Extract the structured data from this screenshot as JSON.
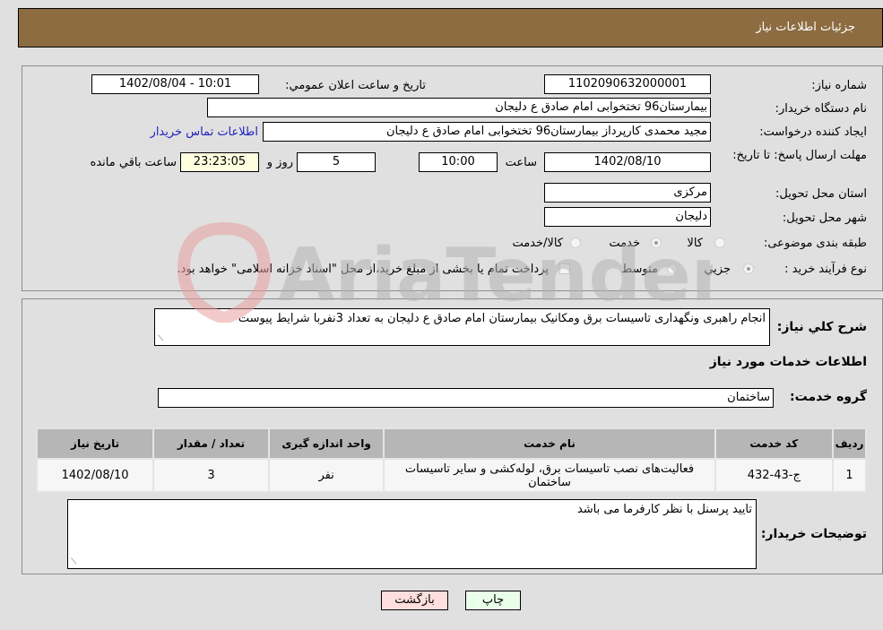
{
  "header": {
    "title": "جزئيات اطلاعات نياز"
  },
  "fields": {
    "need_number_label": "شماره نياز:",
    "need_number": "1102090632000001",
    "announce_label": "تاريخ و ساعت اعلان عمومي:",
    "announce_value": "1402/08/04 - 10:01",
    "buyer_org_label": "نام دستگاه خريدار:",
    "buyer_org": "بيمارستان96 تختخوابی امام صادق  ع   دليجان",
    "creator_label": "ايجاد کننده درخواست:",
    "creator": "مجيد  محمدی  کارپرداز بيمارستان96 تختخوابی امام صادق  ع   دليجان",
    "contact_link": "اطلاعات تماس خريدار",
    "deadline_label": "مهلت ارسال پاسخ: تا تاريخ:",
    "deadline_date": "1402/08/10",
    "time_label": "ساعت",
    "deadline_time": "10:00",
    "days": "5",
    "days_label": "روز و",
    "remaining_time": "23:23:05",
    "remaining_label": "ساعت باقي مانده",
    "province_label": "استان محل تحويل:",
    "province": "مرکزی",
    "city_label": "شهر محل تحويل:",
    "city": "دليجان",
    "category_label": "طبقه بندی موضوعی:",
    "category_options": [
      "کالا",
      "خدمت",
      "کالا/خدمت"
    ],
    "category_selected": "خدمت",
    "process_label": "نوع فرآيند خريد :",
    "process_options": [
      "جزيي",
      "متوسط"
    ],
    "process_selected": "جزيي",
    "treasury_note": "پرداخت تمام يا بخشی از مبلغ خريد،از محل \"اسناد خزانه اسلامی\" خواهد بود."
  },
  "description": {
    "label": "شرح کلي نياز:",
    "value": "انجام راهبری ونگهداری تاسيسات برق ومکانيک بيمارستان امام صادق ع دليجان به تعداد 3نفربا شرايط پيوست"
  },
  "services": {
    "section_title": "اطلاعات خدمات مورد نياز",
    "group_label": "گروه خدمت:",
    "group_value": "ساختمان",
    "columns": [
      "رديف",
      "کد خدمت",
      "نام خدمت",
      "واحد اندازه گيری",
      "تعداد / مقدار",
      "تاريخ نياز"
    ],
    "rows": [
      {
        "index": "1",
        "code": "ج-43-432",
        "name": "فعاليت‌های نصب تاسيسات برق، لوله‌کشی و ساير تاسيسات ساختمان",
        "unit": "نفر",
        "qty": "3",
        "date": "1402/08/10"
      }
    ]
  },
  "buyer_notes": {
    "label": "توضيحات خريدار:",
    "value": "تاييد پرسنل با نظر کارفرما می باشد"
  },
  "buttons": {
    "print": "چاپ",
    "back": "بازگشت"
  },
  "watermark": "AriaTender.net",
  "colors": {
    "header": "#8d6c42",
    "print_bg": "#eaffea",
    "back_bg": "#ffdede",
    "link": "#2020c0"
  }
}
